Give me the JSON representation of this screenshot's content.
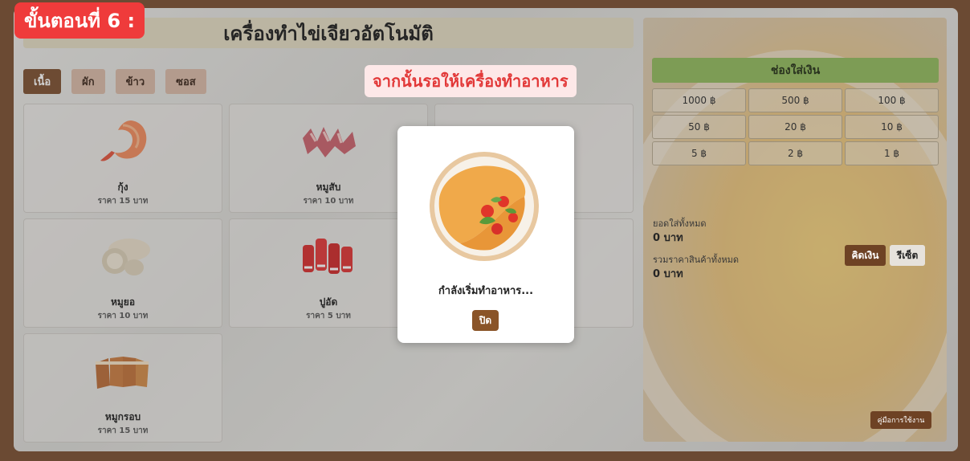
{
  "app": {
    "title": "เครื่องทำไข่เจียวอัตโนมัติ"
  },
  "categories": [
    {
      "label": "เนื้อ",
      "active": true
    },
    {
      "label": "ผัก",
      "active": false
    },
    {
      "label": "ข้าว",
      "active": false
    },
    {
      "label": "ซอส",
      "active": false
    }
  ],
  "items": [
    {
      "name": "กุ้ง",
      "price": "ราคา 15 บาท",
      "icon": "shrimp-icon"
    },
    {
      "name": "หมูสับ",
      "price": "ราคา 10 บาท",
      "icon": "minced-pork-icon"
    },
    {
      "name": "",
      "price": "",
      "icon": ""
    },
    {
      "name": "หมูยอ",
      "price": "ราคา 10 บาท",
      "icon": "pork-sausage-icon"
    },
    {
      "name": "ปูอัด",
      "price": "ราคา 5 บาท",
      "icon": "crab-stick-icon"
    },
    {
      "name": "",
      "price": "",
      "icon": ""
    },
    {
      "name": "หมูกรอบ",
      "price": "ราคา 15 บาท",
      "icon": "crispy-pork-icon"
    }
  ],
  "payment": {
    "header": "ช่องใส่เงิน",
    "denominations": [
      "1000 ฿",
      "500 ฿",
      "100 ฿",
      "50 ฿",
      "20 ฿",
      "10 ฿",
      "5 ฿",
      "2 ฿",
      "1 ฿"
    ],
    "total_inserted_label": "ยอดใส่ทั้งหมด",
    "total_inserted_value": "0 บาท",
    "total_price_label": "รวมราคาสินค้าทั้งหมด",
    "total_price_value": "0 บาท",
    "calc_button": "คิดเงิน",
    "reset_button": "รีเซ็ต",
    "manual_button": "คู่มือการใช้งาน"
  },
  "tutorial": {
    "step_badge": "ขั้นตอนที่ 6 :",
    "callout": "จากนั้นรอให้เครื่องทำอาหาร"
  },
  "modal": {
    "message": "กำลังเริ่มทำอาหาร...",
    "close_button": "ปิด",
    "image_icon": "omelette-icon"
  },
  "colors": {
    "brand_brown": "#7a4d2c",
    "money_header_green": "#8fb85a",
    "step_badge_red": "#ef3b3b",
    "callout_text_red": "#e23838"
  }
}
